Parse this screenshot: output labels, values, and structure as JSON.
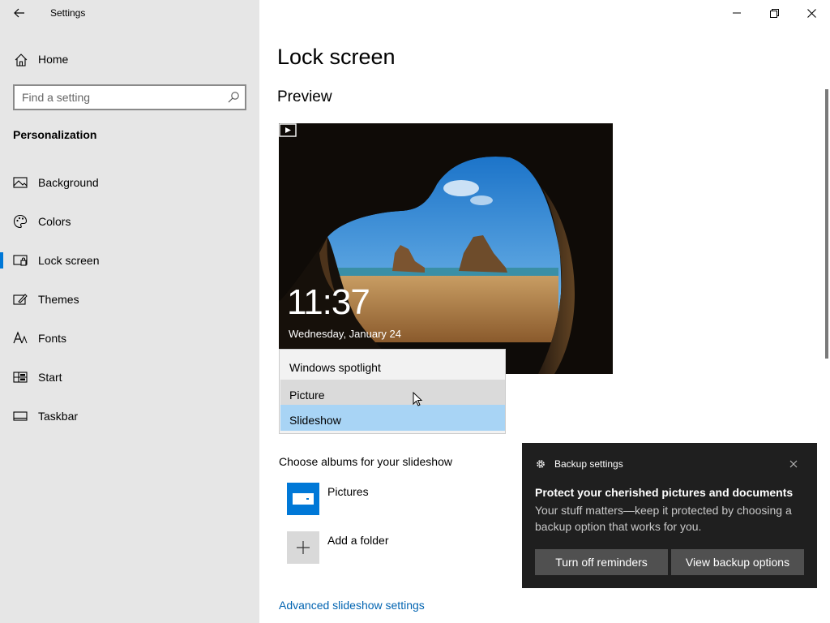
{
  "window": {
    "title": "Settings"
  },
  "sidebar": {
    "home_label": "Home",
    "search_placeholder": "Find a setting",
    "section": "Personalization",
    "items": [
      {
        "label": "Background",
        "icon": "picture-icon"
      },
      {
        "label": "Colors",
        "icon": "palette-icon"
      },
      {
        "label": "Lock screen",
        "icon": "lock-screen-icon",
        "selected": true
      },
      {
        "label": "Themes",
        "icon": "themes-icon"
      },
      {
        "label": "Fonts",
        "icon": "fonts-icon"
      },
      {
        "label": "Start",
        "icon": "start-icon"
      },
      {
        "label": "Taskbar",
        "icon": "taskbar-icon"
      }
    ]
  },
  "main": {
    "page_title": "Lock screen",
    "preview_heading": "Preview",
    "preview": {
      "time": "11:37",
      "date": "Wednesday, January 24"
    },
    "background_dropdown": {
      "options": [
        "Windows spotlight",
        "Picture",
        "Slideshow"
      ],
      "hovered": "Picture",
      "selected": "Slideshow"
    },
    "albums_label": "Choose albums for your slideshow",
    "albums": [
      {
        "name": "Pictures",
        "icon": "pictures-folder-icon"
      },
      {
        "name": "Add a folder",
        "icon": "plus-icon"
      }
    ],
    "advanced_link": "Advanced slideshow settings"
  },
  "toast": {
    "app": "Backup settings",
    "title": "Protect your cherished pictures and documents",
    "body": "Your stuff matters—keep it protected by choosing a backup option that works for you.",
    "buttons": [
      "Turn off reminders",
      "View backup options"
    ]
  },
  "colors": {
    "accent": "#0078d7",
    "link": "#0063b1",
    "dropdown_selected": "#a8d4f5",
    "toast_bg": "#1f1f1f"
  }
}
